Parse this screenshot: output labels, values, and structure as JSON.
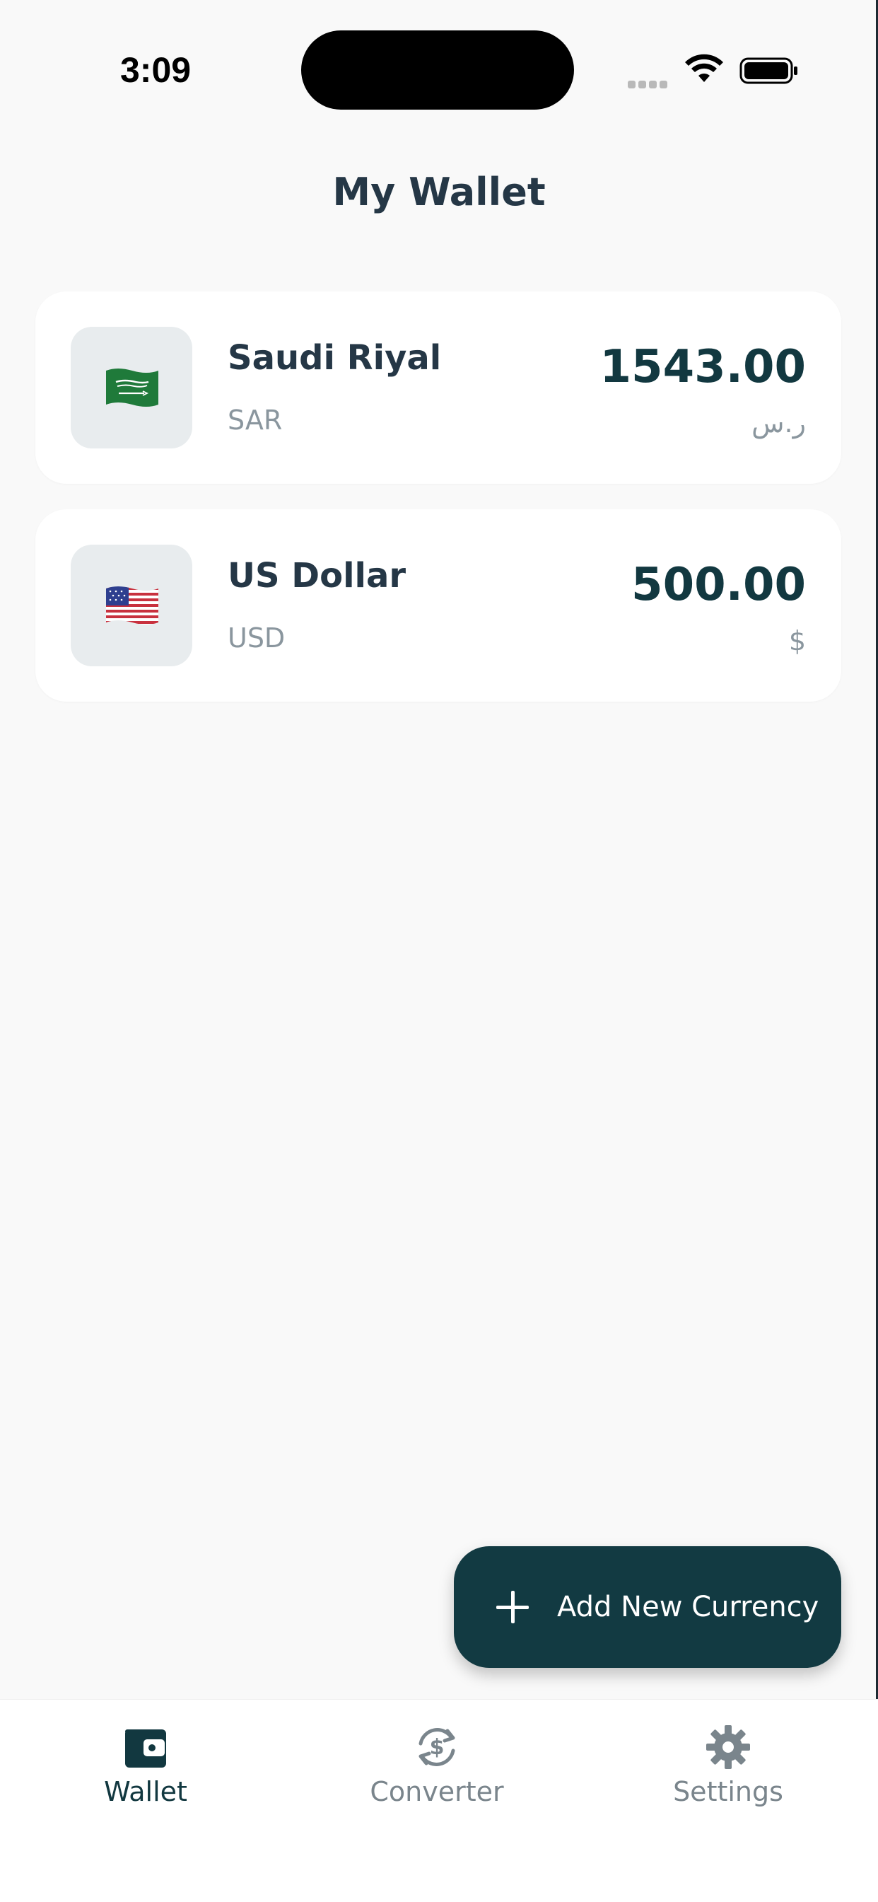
{
  "status_bar": {
    "time": "3:09"
  },
  "header": {
    "title": "My Wallet"
  },
  "currencies": [
    {
      "name": "Saudi Riyal",
      "code": "SAR",
      "amount": "1543.00",
      "symbol": "ر.س",
      "flag_icon": "saudi-arabia-flag-icon"
    },
    {
      "name": "US Dollar",
      "code": "USD",
      "amount": "500.00",
      "symbol": "$",
      "flag_icon": "usa-flag-icon"
    }
  ],
  "fab": {
    "label": "Add New Currency",
    "icon": "plus-icon"
  },
  "tabs": [
    {
      "label": "Wallet",
      "icon": "wallet-icon",
      "active": true
    },
    {
      "label": "Converter",
      "icon": "currency-exchange-icon",
      "active": false
    },
    {
      "label": "Settings",
      "icon": "gear-icon",
      "active": false
    }
  ],
  "colors": {
    "primary": "#123a42",
    "title_text": "#253746",
    "muted_text": "#8a969e",
    "background": "#f9f9f9",
    "card": "#ffffff",
    "flag_box": "#e8ecee"
  }
}
